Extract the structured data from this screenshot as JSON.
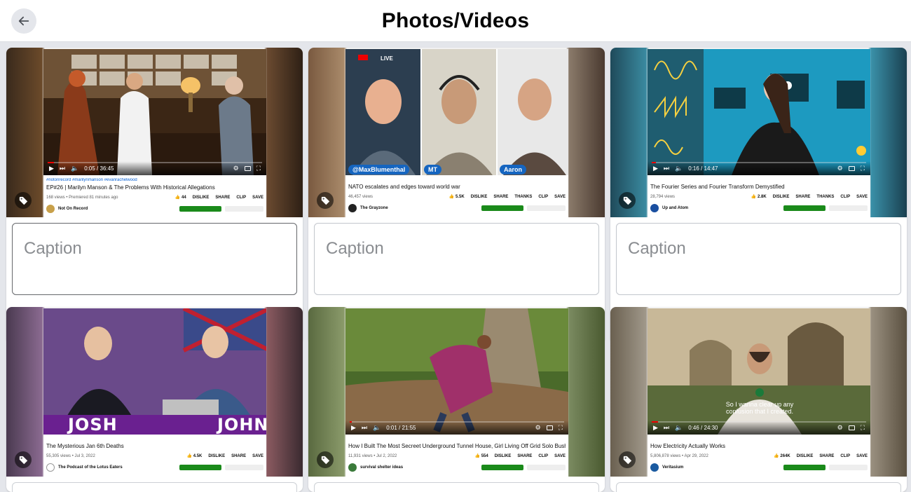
{
  "header": {
    "title": "Photos/Videos",
    "back_label": "Back"
  },
  "caption_placeholder": "Caption",
  "cards": [
    {
      "hashtags": "#notonrecord #marilynmanson #evanrachelwood",
      "video_title": "EP#26 | Marilyn Manson & The Problems With Historical Allegations",
      "views": "168 views • Premiered 81 minutes ago",
      "likes": "44",
      "actions": [
        "DISLIKE",
        "SHARE",
        "CLIP",
        "SAVE"
      ],
      "channel": "Not On Record",
      "time": "0:05 / 36:45",
      "progress": 0.02
    },
    {
      "hashtags": "",
      "video_title": "NATO escalates and edges toward world war",
      "views": "46,457 views",
      "likes": "5.5K",
      "actions": [
        "DISLIKE",
        "SHARE",
        "THANKS",
        "CLIP",
        "SAVE"
      ],
      "channel": "The Grayzone",
      "labels": [
        "@MaxBlumenthal",
        "MT",
        "Aaron"
      ],
      "live": "LIVE",
      "time": "",
      "progress": 0
    },
    {
      "hashtags": "",
      "video_title": "The Fourier Series and Fourier Transform Demystified",
      "views": "28,794 views",
      "likes": "2.8K",
      "actions": [
        "DISLIKE",
        "SHARE",
        "THANKS",
        "CLIP",
        "SAVE"
      ],
      "channel": "Up and Atom",
      "time": "0:16 / 14:47",
      "progress": 0.02
    },
    {
      "hashtags": "",
      "video_title": "The Mysterious Jan 6th Deaths",
      "views": "55,305 views • Jul 3, 2022",
      "likes": "4.5K",
      "actions": [
        "DISLIKE",
        "SHARE",
        "SAVE"
      ],
      "channel": "The Podcast of the Lotus Eaters",
      "names": [
        "JOSH",
        "JOHN"
      ],
      "time": "",
      "progress": 0
    },
    {
      "hashtags": "",
      "video_title": "How I Built The Most Secreet Underground Tunnel House, Girl Living Off Grid Solo Bushcrafts",
      "views": "11,931 views • Jul 2, 2022",
      "likes": "554",
      "actions": [
        "DISLIKE",
        "SHARE",
        "CLIP",
        "SAVE"
      ],
      "channel": "survival shelter ideas",
      "time": "0:01 / 21:55",
      "progress": 0.01
    },
    {
      "hashtags": "",
      "video_title": "How Electricity Actually Works",
      "views": "5,806,878 views • Apr 29, 2022",
      "likes": "264K",
      "actions": [
        "DISLIKE",
        "SHARE",
        "CLIP",
        "SAVE"
      ],
      "channel": "Veritasium",
      "subtitle": "So I wanna clear up any confusion that I created.",
      "time": "0:46 / 24:30",
      "progress": 0.03
    }
  ],
  "colors": {
    "accent": "#1877f2",
    "yt_red": "#ff0000",
    "subscribe_green": "#1a8a1a"
  }
}
